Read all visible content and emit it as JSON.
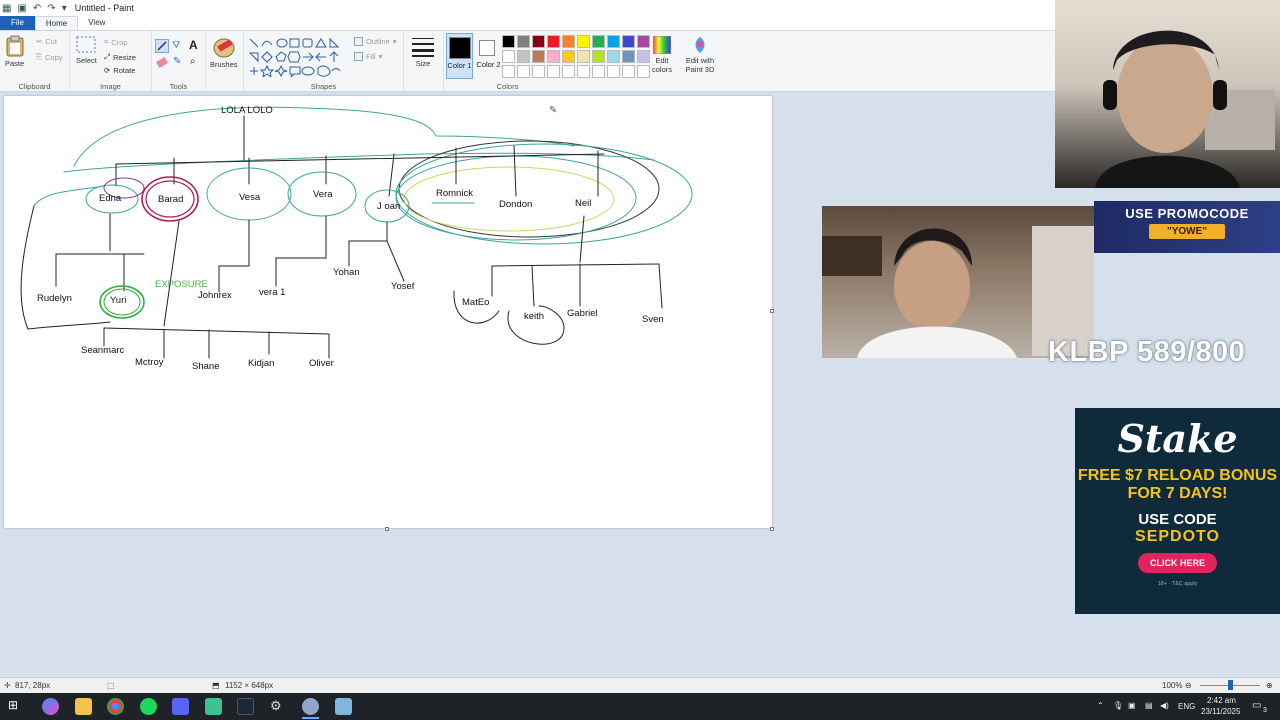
{
  "window": {
    "title": "Untitled - Paint"
  },
  "tabs": [
    "File",
    "Home",
    "View"
  ],
  "ribbon": {
    "clipboard": {
      "label": "Clipboard",
      "paste": "Paste",
      "cut": "Cut",
      "copy": "Copy"
    },
    "image": {
      "label": "Image",
      "select": "Select",
      "crop": "Crop",
      "resize": "Resize",
      "rotate": "Rotate"
    },
    "tools": {
      "label": "Tools"
    },
    "brushes": "Brushes",
    "shapes": {
      "label": "Shapes",
      "outline": "Outline",
      "fill": "Fill"
    },
    "size": "Size",
    "color1": "Color 1",
    "color2": "Color 2",
    "colors": {
      "label": "Colors",
      "edit": "Edit colors",
      "paint3d": "Edit with Paint 3D"
    },
    "palette": [
      "#000000",
      "#7f7f7f",
      "#880015",
      "#ed1c24",
      "#ff7f27",
      "#fff200",
      "#22b14c",
      "#00a2e8",
      "#3f48cc",
      "#a349a4",
      "#ffffff",
      "#c3c3c3",
      "#b97a57",
      "#ffaec9",
      "#ffc90e",
      "#efe4b0",
      "#b5e61d",
      "#99d9ea",
      "#7092be",
      "#c8bfe7",
      "#ffffff",
      "#ffffff",
      "#ffffff",
      "#ffffff",
      "#ffffff",
      "#ffffff",
      "#ffffff",
      "#ffffff",
      "#ffffff",
      "#ffffff"
    ]
  },
  "drawing": {
    "root": "LOLA LOLO",
    "gen2": [
      "Edna",
      "Barad",
      "Vesa",
      "Vera",
      "J oan",
      "Romnick",
      "Dondon",
      "Neil"
    ],
    "gen3": [
      "Rudelyn",
      "Yuri",
      "EXPOSURE",
      "Johnrex",
      "vera 1",
      "Yohan",
      "Yosef",
      "MatEo",
      "keith",
      "Gabriel",
      "Sven"
    ],
    "gen4": [
      "Seanmarc",
      "Mctroy",
      "Shane",
      "Kidjan",
      "Oliver"
    ]
  },
  "status": {
    "cursor": "817, 28px",
    "canvas_size": "1152 × 648px",
    "zoom": "100%"
  },
  "taskbar": {
    "lang": "ENG",
    "time": "2:42 am",
    "date": "23/11/2025",
    "notif": "3"
  },
  "overlays": {
    "promo_line1": "USE PROMOCODE",
    "promo_code": "\"YOWE\"",
    "battlepass": "KLBP 589/800",
    "stake_logo": "Stake",
    "stake_offer": "FREE $7 RELOAD BONUS FOR 7 DAYS!",
    "stake_use": "USE CODE",
    "stake_code": "SEPDOTO",
    "stake_cta": "CLICK HERE",
    "stake_terms": "18+ · T&C apply"
  }
}
